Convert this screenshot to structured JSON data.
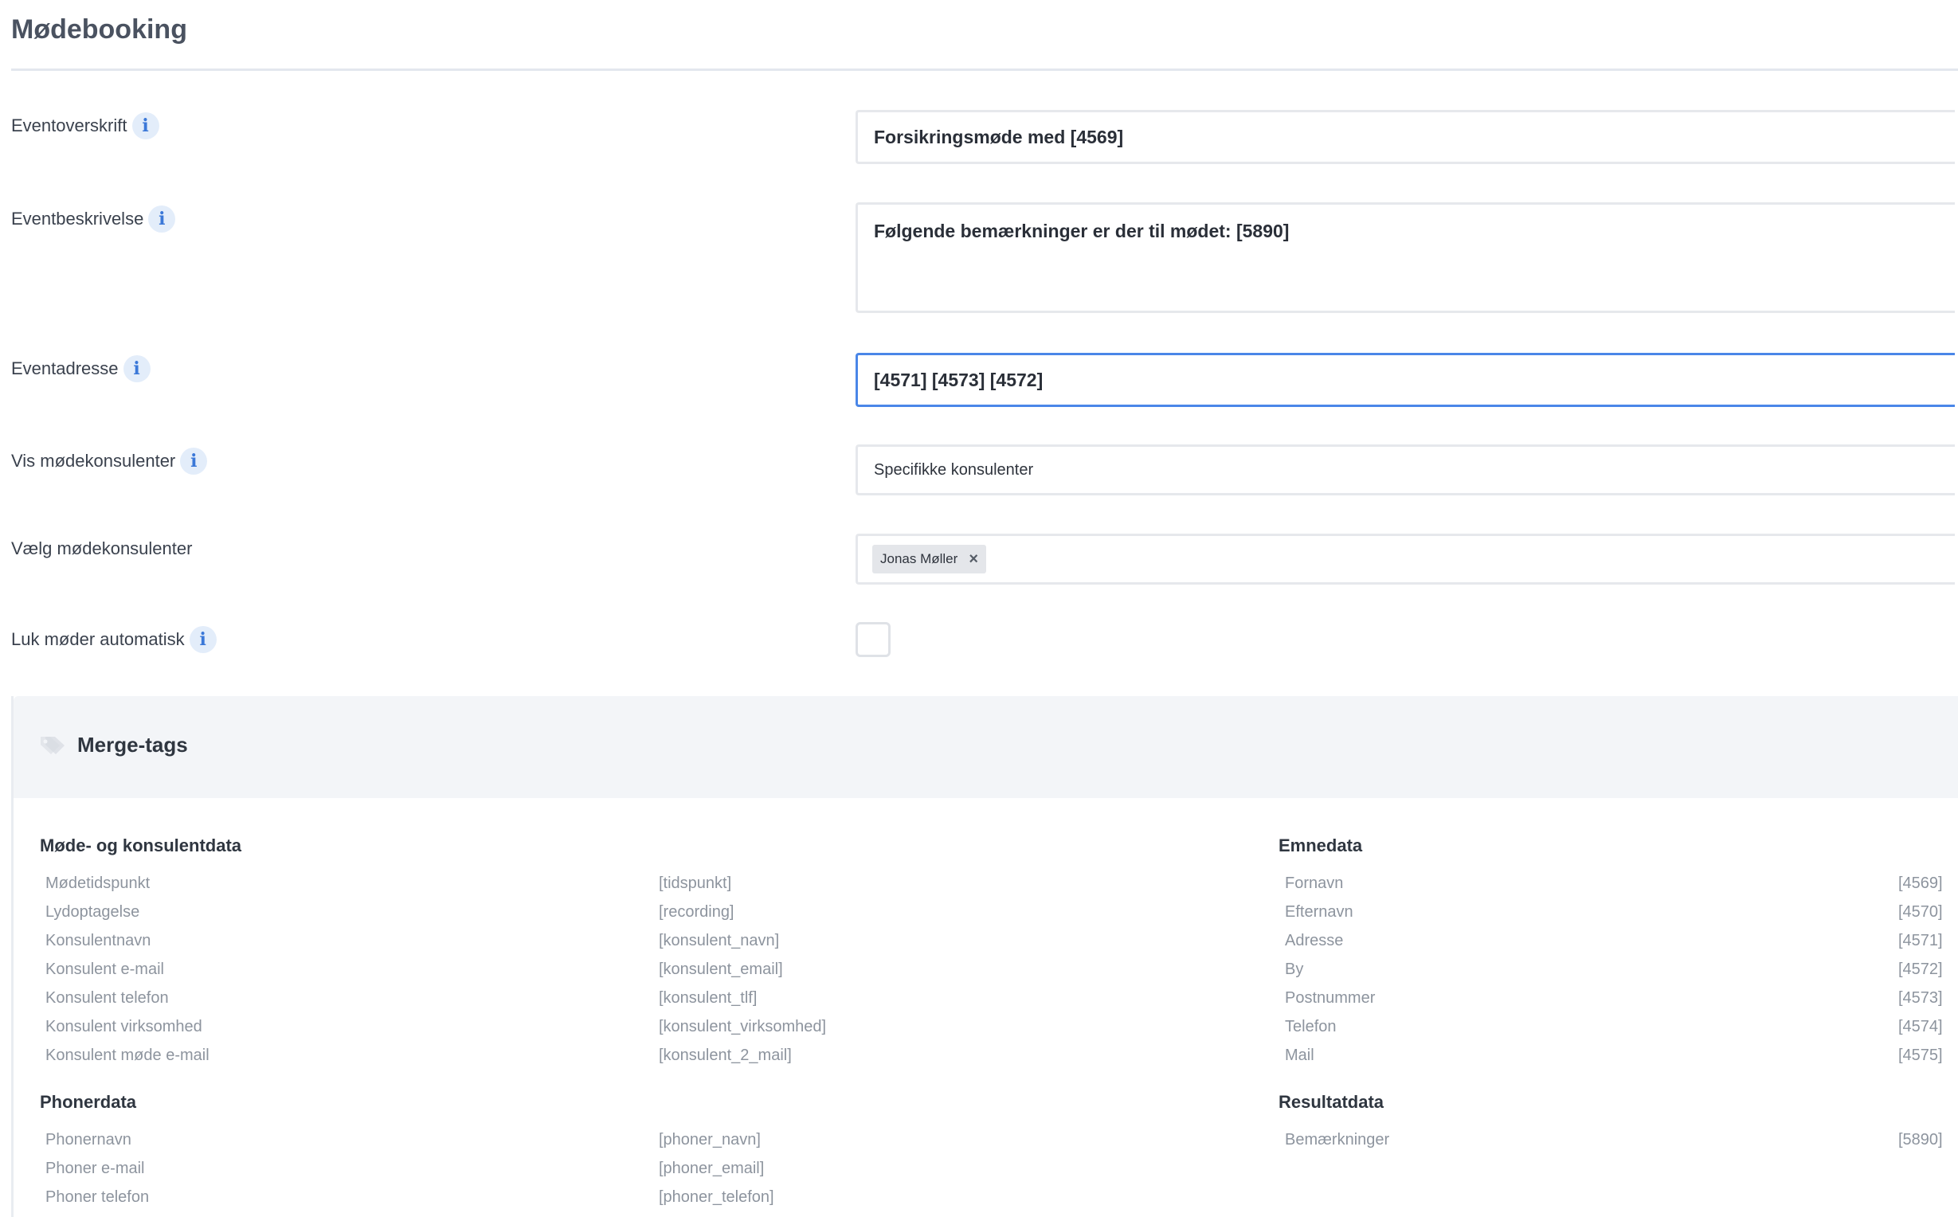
{
  "page_title": "Mødebooking",
  "fields": {
    "headline": {
      "label": "Eventoverskrift",
      "value": "Forsikringsmøde med [4569]"
    },
    "description": {
      "label": "Eventbeskrivelse",
      "value": "Følgende bemærkninger er der til mødet: [5890]"
    },
    "address": {
      "label": "Eventadresse",
      "value": "[4571] [4573] [4572]"
    },
    "show_consultants": {
      "label": "Vis mødekonsulenter",
      "value": "Specifikke konsulenter"
    },
    "choose_consultants": {
      "label": "Vælg mødekonsulenter",
      "tags": [
        "Jonas Møller"
      ],
      "remove_symbol": "×"
    },
    "auto_close": {
      "label": "Luk møder automatisk",
      "checked": false
    }
  },
  "info_icon_glyph": "i",
  "merge_tags": {
    "title": "Merge-tags",
    "icon": "tag-icon",
    "groups": [
      {
        "title": "Møde- og konsulentdata",
        "rows": [
          {
            "label": "Mødetidspunkt",
            "tag": "[tidspunkt]"
          },
          {
            "label": "Lydoptagelse",
            "tag": "[recording]"
          },
          {
            "label": "Konsulentnavn",
            "tag": "[konsulent_navn]"
          },
          {
            "label": "Konsulent e-mail",
            "tag": "[konsulent_email]"
          },
          {
            "label": "Konsulent telefon",
            "tag": "[konsulent_tlf]"
          },
          {
            "label": "Konsulent virksomhed",
            "tag": "[konsulent_virksomhed]"
          },
          {
            "label": "Konsulent møde e-mail",
            "tag": "[konsulent_2_mail]"
          }
        ]
      },
      {
        "title": "Phonerdata",
        "rows": [
          {
            "label": "Phonernavn",
            "tag": "[phoner_navn]"
          },
          {
            "label": "Phoner e-mail",
            "tag": "[phoner_email]"
          },
          {
            "label": "Phoner telefon",
            "tag": "[phoner_telefon]"
          }
        ]
      },
      {
        "title": "Emnedata",
        "rows": [
          {
            "label": "Fornavn",
            "tag": "[4569]"
          },
          {
            "label": "Efternavn",
            "tag": "[4570]"
          },
          {
            "label": "Adresse",
            "tag": "[4571]"
          },
          {
            "label": "By",
            "tag": "[4572]"
          },
          {
            "label": "Postnummer",
            "tag": "[4573]"
          },
          {
            "label": "Telefon",
            "tag": "[4574]"
          },
          {
            "label": "Mail",
            "tag": "[4575]"
          }
        ]
      },
      {
        "title": "Resultatdata",
        "rows": [
          {
            "label": "Bemærkninger",
            "tag": "[5890]"
          }
        ]
      }
    ]
  },
  "colors": {
    "accent": "#4a86e8",
    "info_bg": "#e3edfa",
    "panel_header_bg": "#f3f5f8",
    "muted_text": "#8d949e"
  }
}
